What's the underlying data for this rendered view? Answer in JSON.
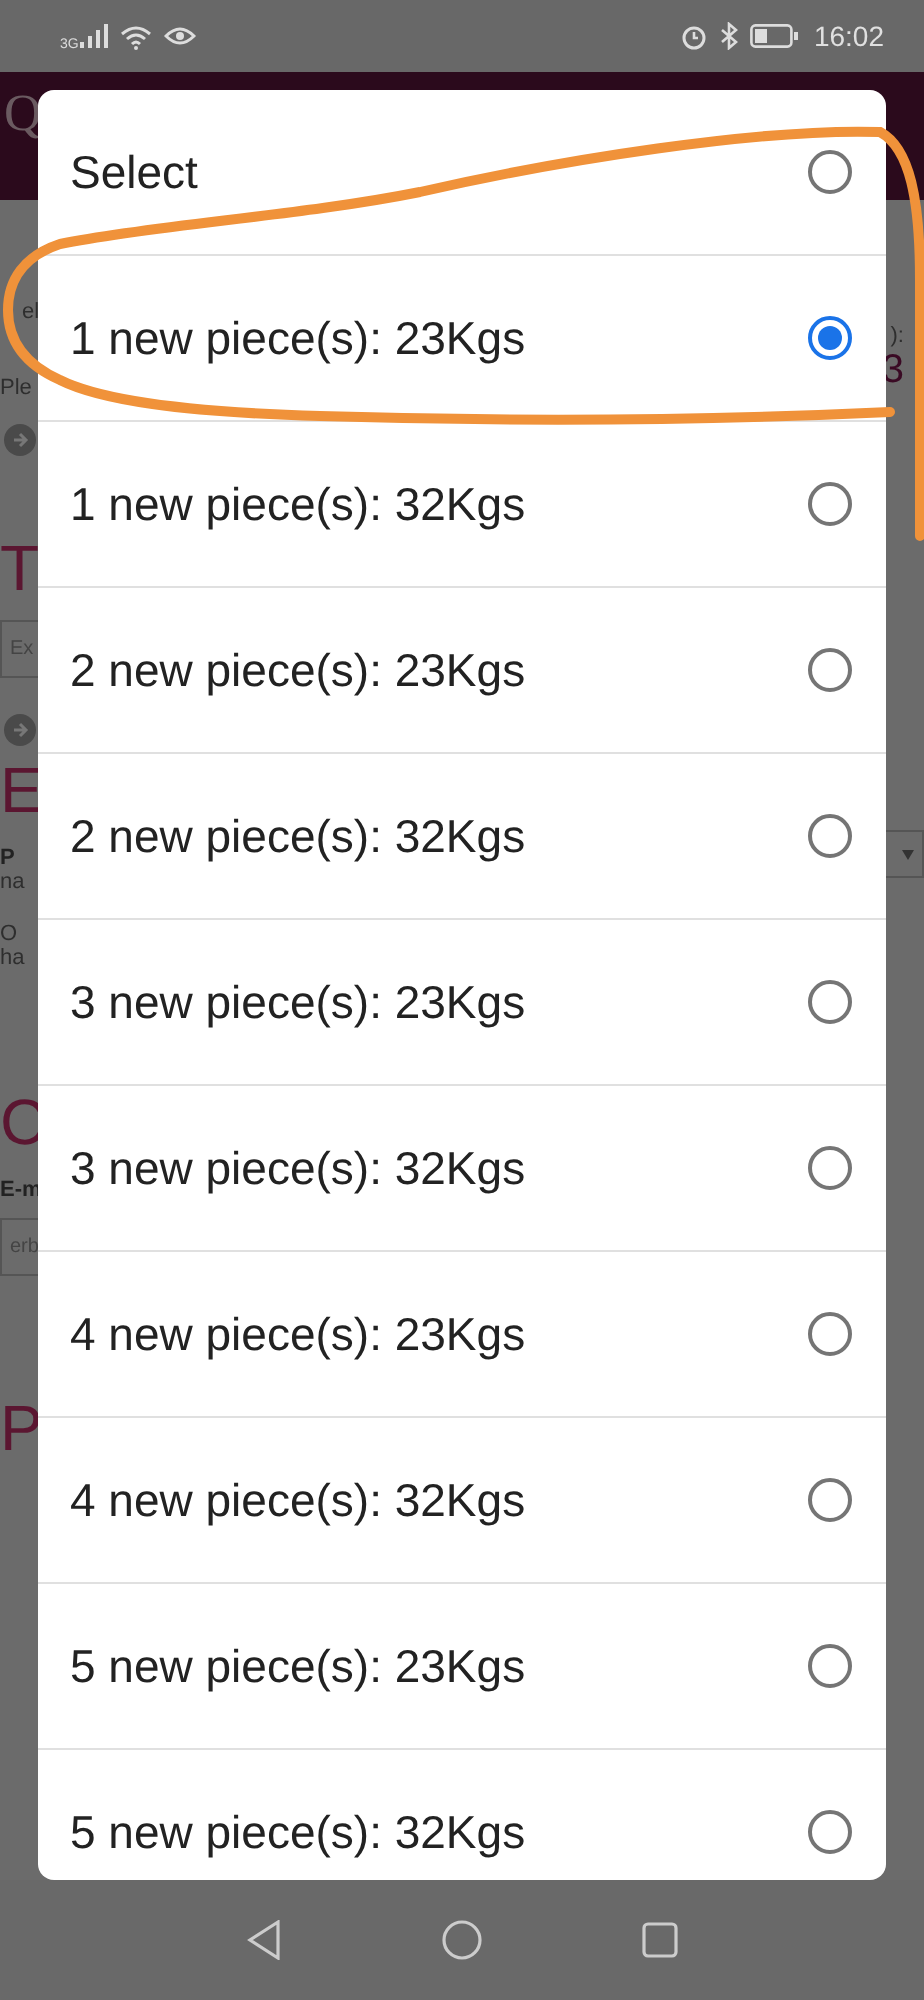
{
  "status_bar": {
    "network": "3G",
    "time": "16:02"
  },
  "backdrop": {
    "left": [
      {
        "kind": "heading",
        "text": "Q"
      },
      {
        "kind": "small",
        "text": "el"
      },
      {
        "kind": "small",
        "text": "Ple"
      },
      {
        "kind": "icon"
      },
      {
        "kind": "heading",
        "text": "T"
      },
      {
        "kind": "input",
        "text": "Ex"
      },
      {
        "kind": "icon"
      },
      {
        "kind": "heading",
        "text": "E"
      },
      {
        "kind": "bold",
        "text": "P"
      },
      {
        "kind": "small",
        "text": "na"
      },
      {
        "kind": "small",
        "text": "O"
      },
      {
        "kind": "small",
        "text": "ha"
      },
      {
        "kind": "heading",
        "text": "C"
      },
      {
        "kind": "bold",
        "text": "E-m"
      },
      {
        "kind": "input",
        "text": "erb"
      },
      {
        "kind": "heading",
        "text": "P"
      }
    ],
    "right": [
      {
        "kind": "small",
        "text": "):"
      },
      {
        "kind": "value",
        "text": "3"
      },
      {
        "kind": "select"
      }
    ]
  },
  "dialog": {
    "options": [
      {
        "label": "Select",
        "selected": false
      },
      {
        "label": "1 new piece(s): 23Kgs",
        "selected": true
      },
      {
        "label": "1 new piece(s): 32Kgs",
        "selected": false
      },
      {
        "label": "2 new piece(s): 23Kgs",
        "selected": false
      },
      {
        "label": "2 new piece(s): 32Kgs",
        "selected": false
      },
      {
        "label": "3 new piece(s): 23Kgs",
        "selected": false
      },
      {
        "label": "3 new piece(s): 32Kgs",
        "selected": false
      },
      {
        "label": "4 new piece(s): 23Kgs",
        "selected": false
      },
      {
        "label": "4 new piece(s): 32Kgs",
        "selected": false
      },
      {
        "label": "5 new piece(s): 23Kgs",
        "selected": false
      },
      {
        "label": "5 new piece(s): 32Kgs",
        "selected": false
      }
    ]
  }
}
